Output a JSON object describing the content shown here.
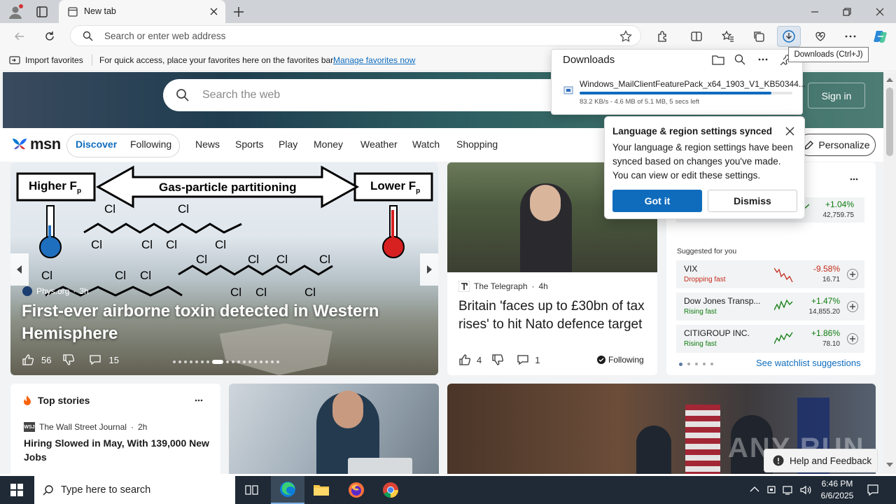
{
  "browser": {
    "tab_title": "New tab",
    "address_placeholder": "Search or enter web address"
  },
  "favbar": {
    "import_label": "Import favorites",
    "hint": "For quick access, place your favorites here on the favorites bar.",
    "manage_link": "Manage favorites now"
  },
  "downloads": {
    "title": "Downloads",
    "tooltip": "Downloads (Ctrl+J)",
    "file_name": "Windows_MailClientFeaturePack_x64_1903_V1_KB50344...",
    "status": "83.2 KB/s - 4.6 MB of 5.1 MB, 5 secs left",
    "progress": 0.9
  },
  "msn": {
    "search_placeholder": "Search the web",
    "sign_in": "Sign in",
    "logo": "msn",
    "tabs": [
      "Discover",
      "Following"
    ],
    "nav": [
      "News",
      "Sports",
      "Play",
      "Money",
      "Weather",
      "Watch",
      "Shopping"
    ],
    "personalize": "Personalize"
  },
  "lang_popup": {
    "title": "Language & region settings synced",
    "body": "Your language & region settings have been synced based on changes you've made. You can view or edit these settings.",
    "got_it": "Got it",
    "dismiss": "Dismiss"
  },
  "hero_story": {
    "figure_labels": {
      "left": "Higher F",
      "left_sub": "p",
      "center": "Gas-particle partitioning",
      "right": "Lower F",
      "right_sub": "p",
      "atom": "Cl"
    },
    "source": "Phys.org",
    "age": "3h",
    "headline": "First-ever airborne toxin detected in Western Hemisphere",
    "likes": "56",
    "comments": "15"
  },
  "telegraph_story": {
    "source": "The Telegraph",
    "age": "4h",
    "headline": "Britain 'faces up to £30bn of tax rises' to hit Nato defence target",
    "likes": "4",
    "comments": "1",
    "following": "Following"
  },
  "watchlist": {
    "top_change": "+1.04%",
    "top_value": "42,759.75",
    "suggested_label": "Suggested for you",
    "rows": [
      {
        "name": "VIX",
        "status": "Dropping fast",
        "change": "-9.58%",
        "value": "16.71",
        "color": "#c42b1c"
      },
      {
        "name": "Dow Jones Transp...",
        "status": "Rising fast",
        "change": "+1.47%",
        "value": "14,855.20",
        "color": "#0f7b0f"
      },
      {
        "name": "CITIGROUP INC.",
        "status": "Rising fast",
        "change": "+1.86%",
        "value": "78.10",
        "color": "#0f7b0f"
      }
    ],
    "see_more": "See watchlist suggestions"
  },
  "top_stories": {
    "title": "Top stories",
    "source": "The Wall Street Journal",
    "source_badge": "WSJ",
    "age": "2h",
    "headline": "Hiring Slowed in May, With 139,000 New Jobs"
  },
  "feedback": "Help and Feedback",
  "watermark": "ANY RUN",
  "taskbar": {
    "search_placeholder": "Type here to search",
    "time": "6:46 PM",
    "date": "6/6/2025"
  },
  "colors": {
    "accent": "#0f6cbd",
    "msn_blue": "#0078d4"
  }
}
